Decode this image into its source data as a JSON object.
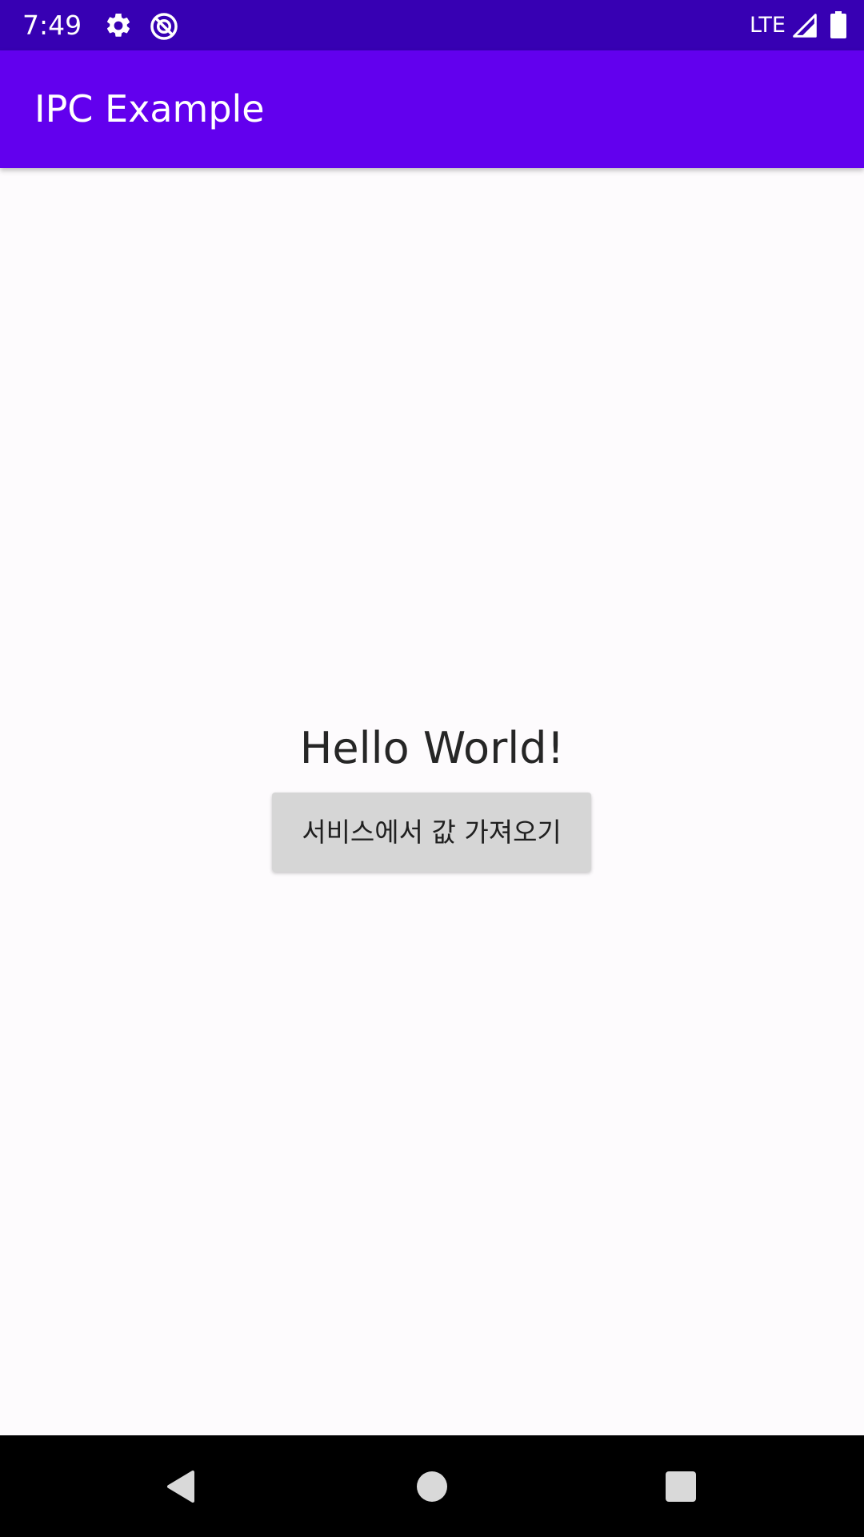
{
  "status_bar": {
    "time": "7:49",
    "network": "LTE",
    "icons": [
      "settings-icon",
      "do-not-disturb-icon",
      "signal-icon",
      "battery-icon"
    ],
    "background": "#3700b3"
  },
  "app_bar": {
    "title": "IPC Example",
    "background": "#6200ee"
  },
  "main": {
    "message": "Hello World!",
    "button_label": "서비스에서 값 가져오기"
  },
  "nav_bar": {
    "icons": [
      "back-icon",
      "home-icon",
      "recents-icon"
    ]
  }
}
